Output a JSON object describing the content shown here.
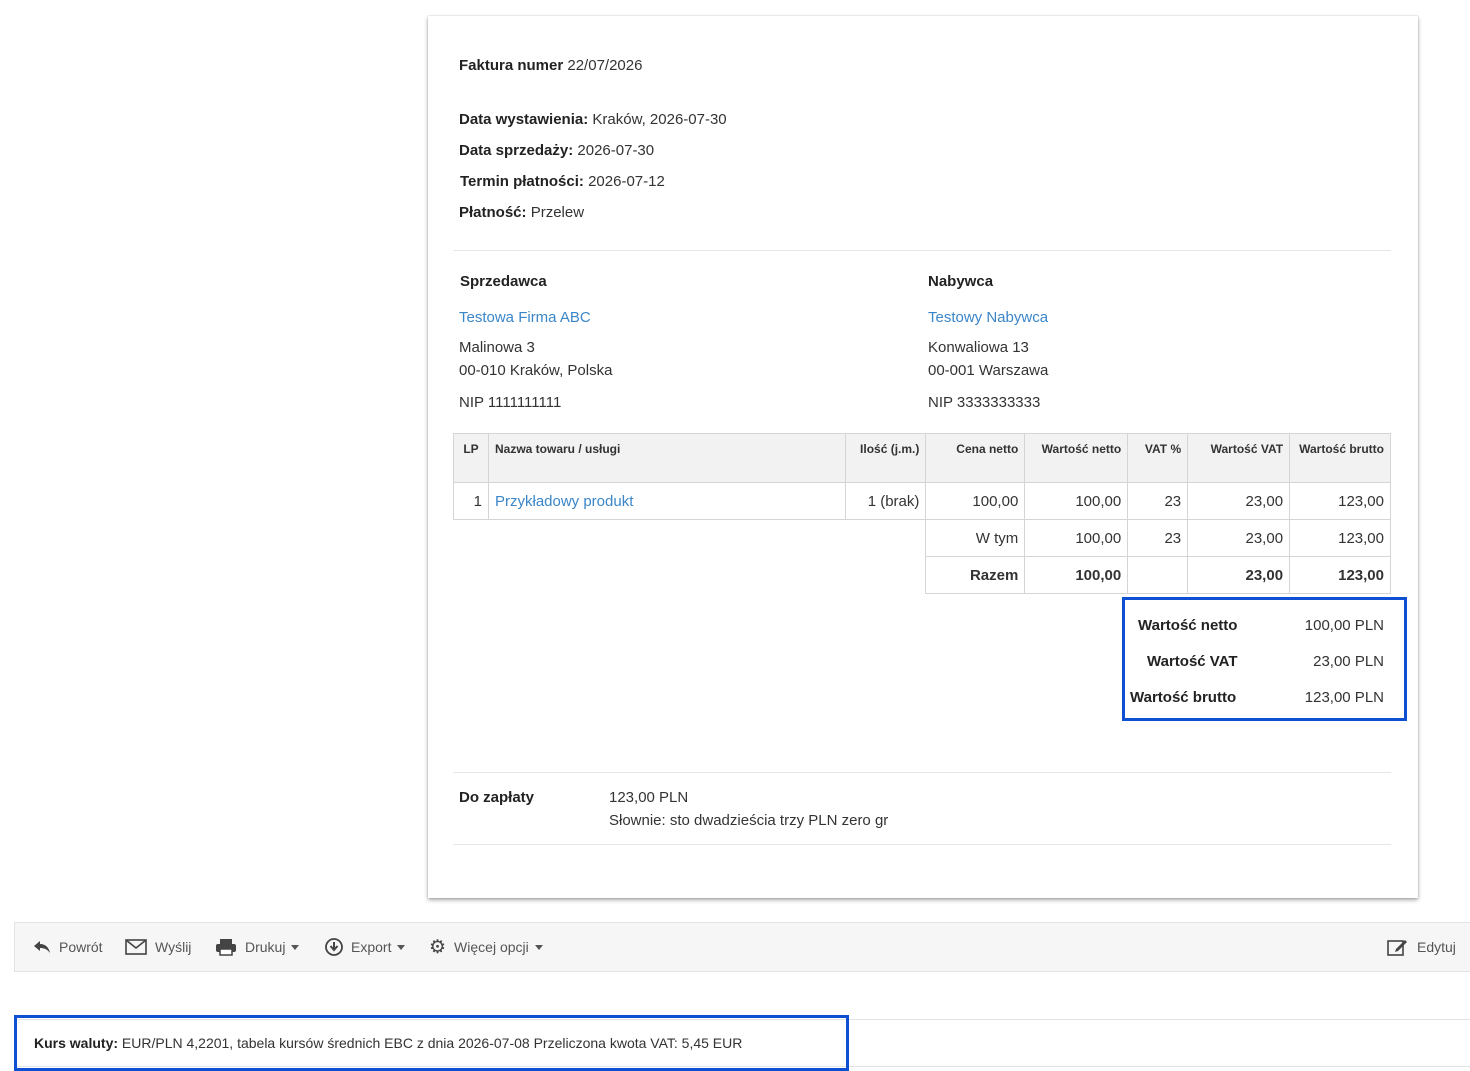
{
  "header": {
    "invoice_label": "Faktura numer",
    "invoice_number": "22/07/2026",
    "issue_label": "Data wystawienia:",
    "issue_value": "Kraków, 2026-07-30",
    "sale_label": "Data sprzedaży:",
    "sale_value": "2026-07-30",
    "due_label": "Termin płatności:",
    "due_value": "2026-07-12",
    "payment_label": "Płatność:",
    "payment_value": "Przelew"
  },
  "seller": {
    "heading": "Sprzedawca",
    "name": "Testowa Firma ABC",
    "street": "Malinowa 3",
    "city": "00-010 Kraków, Polska",
    "nip": "NIP 1111111111"
  },
  "buyer": {
    "heading": "Nabywca",
    "name": "Testowy Nabywca",
    "street": "Konwaliowa 13",
    "city": "00-001 Warszawa",
    "nip": "NIP 3333333333"
  },
  "table": {
    "headers": [
      "LP",
      "Nazwa towaru / usługi",
      "Ilość (j.m.)",
      "Cena netto",
      "Wartość netto",
      "VAT %",
      "Wartość VAT",
      "Wartość brutto"
    ],
    "rows": [
      {
        "lp": "1",
        "name": "Przykładowy produkt",
        "qty": "1 (brak)",
        "price": "100,00",
        "net": "100,00",
        "vat_pct": "23",
        "vat": "23,00",
        "gross": "123,00"
      }
    ],
    "subtotal": {
      "label": "W tym",
      "net": "100,00",
      "vat_pct": "23",
      "vat": "23,00",
      "gross": "123,00"
    },
    "total": {
      "label": "Razem",
      "net": "100,00",
      "vat": "23,00",
      "gross": "123,00"
    }
  },
  "summary": {
    "net_label": "Wartość netto",
    "net_value": "100,00 PLN",
    "vat_label": "Wartość VAT",
    "vat_value": "23,00 PLN",
    "gross_label": "Wartość brutto",
    "gross_value": "123,00 PLN"
  },
  "payment_due": {
    "label": "Do zapłaty",
    "amount": "123,00 PLN",
    "words": "Słownie: sto dwadzieścia trzy PLN zero gr"
  },
  "toolbar": {
    "back": "Powrót",
    "send": "Wyślij",
    "print": "Drukuj",
    "export": "Export",
    "more": "Więcej opcji",
    "edit": "Edytuj"
  },
  "exchange": {
    "label": "Kurs waluty:",
    "text": "EUR/PLN 4,2201, tabela kursów średnich EBC z dnia 2026-07-08 Przeliczona kwota VAT: 5,45 EUR"
  },
  "colors": {
    "link": "#3a86c8",
    "highlight": "#0f4fd1"
  }
}
